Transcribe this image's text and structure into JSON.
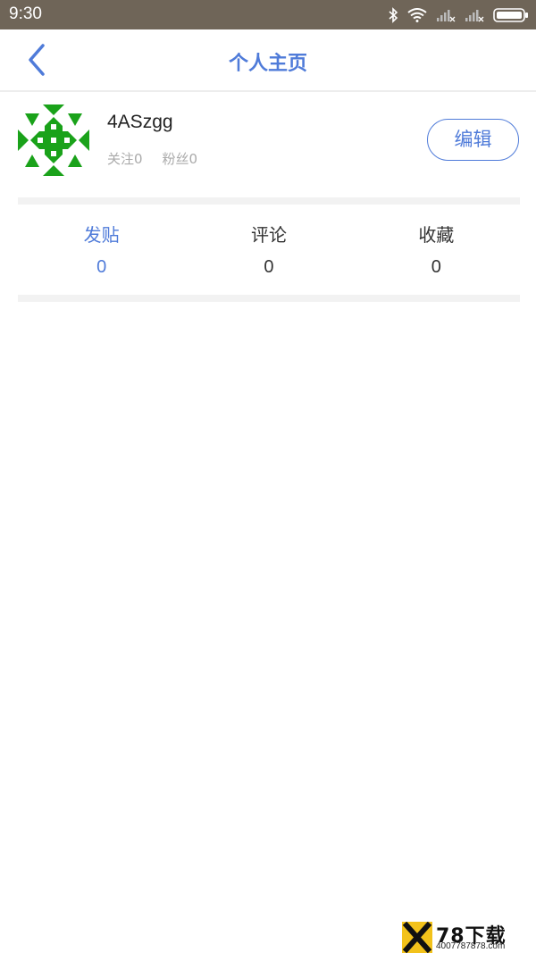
{
  "status_bar": {
    "time": "9:30"
  },
  "nav": {
    "title": "个人主页"
  },
  "profile": {
    "username": "4ASzgg",
    "following": "关注0",
    "followers": "粉丝0",
    "edit_label": "编辑"
  },
  "tabs": [
    {
      "label": "发贴",
      "count": "0",
      "active": true
    },
    {
      "label": "评论",
      "count": "0",
      "active": false
    },
    {
      "label": "收藏",
      "count": "0",
      "active": false
    }
  ],
  "colors": {
    "accent": "#4f7bd9",
    "status_bar": "#6f6558",
    "avatar_green": "#1aa21a"
  },
  "watermark": {
    "title": "78下载",
    "phone": "4007787878.com"
  }
}
